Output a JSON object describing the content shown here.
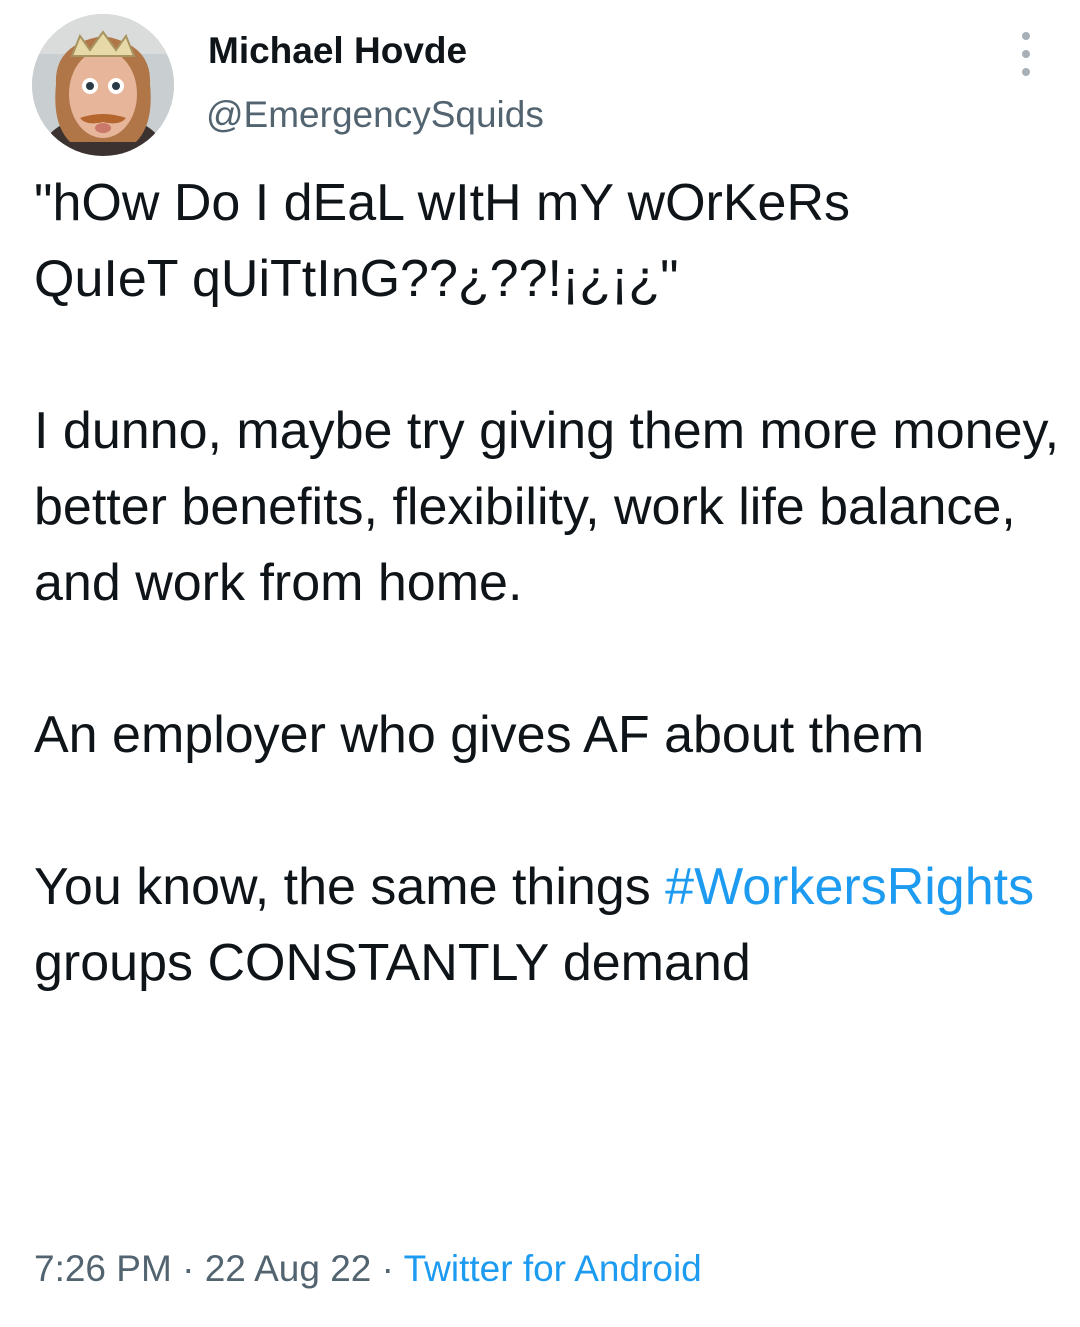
{
  "author": {
    "display_name": "Michael Hovde",
    "handle": "@EmergencySquids",
    "avatar_icon": "profile-photo"
  },
  "menu": {
    "more_icon": "more-vertical-icon"
  },
  "tweet": {
    "line1": "\"hOw Do I dEaL wItH mY wOrKeRs",
    "line2": "QuIeT qUiTtInG??¿??!¡¿¡¿\"",
    "para2": "I dunno, maybe try giving them more money, better benefits, flexibility, work life balance, and work from home.",
    "para3": "An employer who gives AF about them",
    "para4_prefix": "You know, the same things ",
    "hashtag": "#WorkersRights",
    "para4_suffix": " groups CONSTANTLY demand"
  },
  "meta": {
    "time": "7:26 PM",
    "sep1": " · ",
    "date": "22 Aug 22",
    "sep2": " · ",
    "source": "Twitter for Android"
  },
  "colors": {
    "text": "#0f1419",
    "secondary": "#536471",
    "link": "#1d9bf0"
  }
}
